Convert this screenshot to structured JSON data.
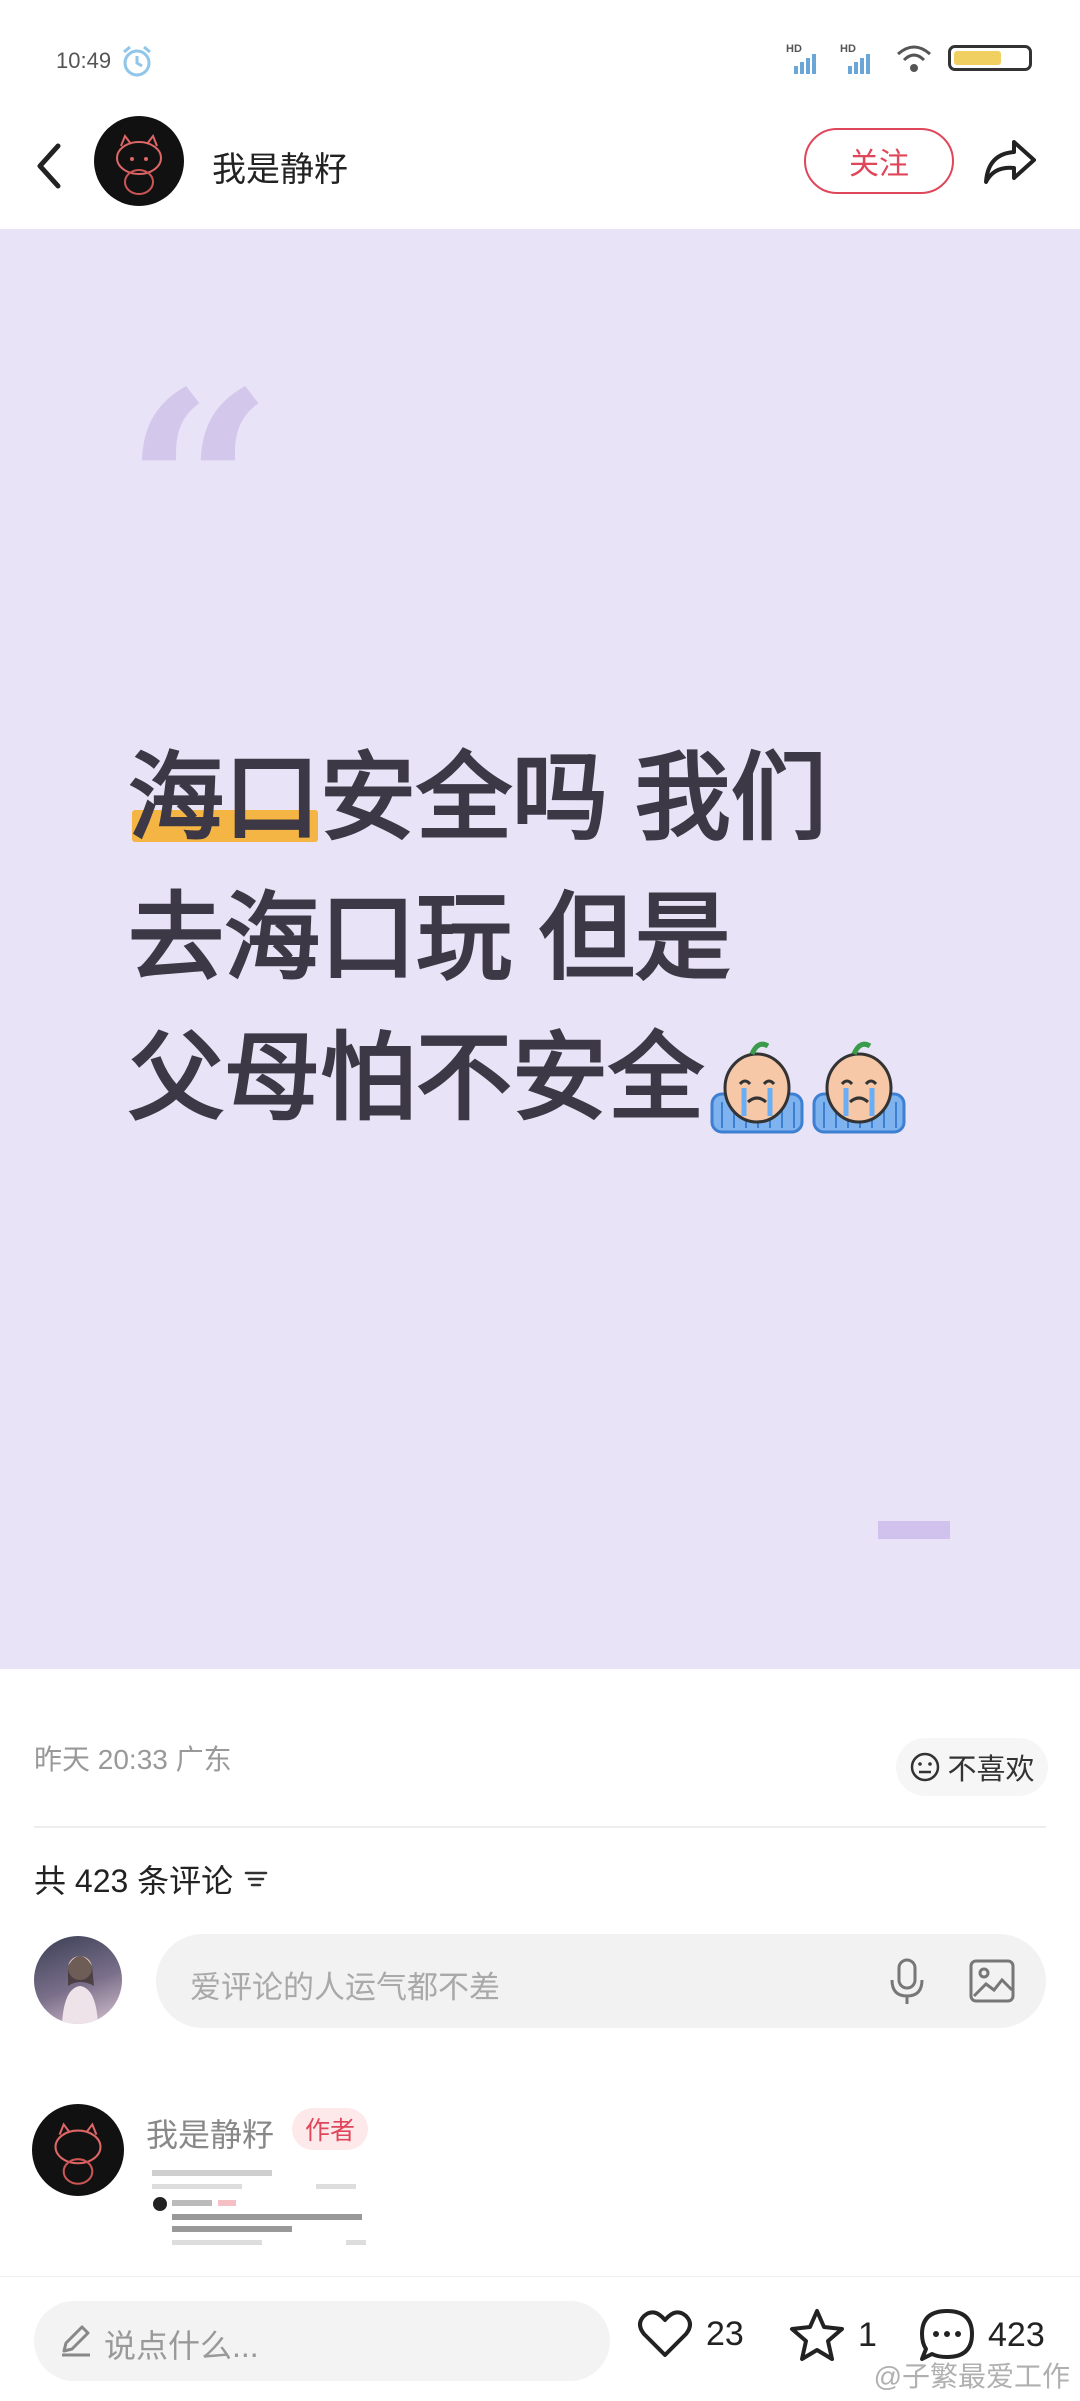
{
  "status_bar": {
    "time": "10:49",
    "signal_1_label": "HD",
    "signal_2_label": "HD"
  },
  "header": {
    "username": "我是静籽",
    "follow_label": "关注"
  },
  "post": {
    "lines": [
      "海口安全吗 我们",
      "去海口玩 但是",
      "父母怕不安全"
    ],
    "emoji": [
      "crying-face-emoji",
      "crying-face-emoji"
    ],
    "meta": "昨天 20:33 广东",
    "dislike_label": "不喜欢"
  },
  "comments": {
    "count_text": "共 423 条评论",
    "input_placeholder": "爱评论的人运气都不差",
    "items": [
      {
        "username": "我是静籽",
        "badge": "作者"
      }
    ]
  },
  "bottom_bar": {
    "input_placeholder": "说点什么...",
    "likes": "23",
    "favorites": "1",
    "comments": "423"
  },
  "watermark": "@子繁最爱工作",
  "colors": {
    "accent": "#e0465a",
    "card_background": "#e9e3f8",
    "highlight": "#f5b544"
  }
}
